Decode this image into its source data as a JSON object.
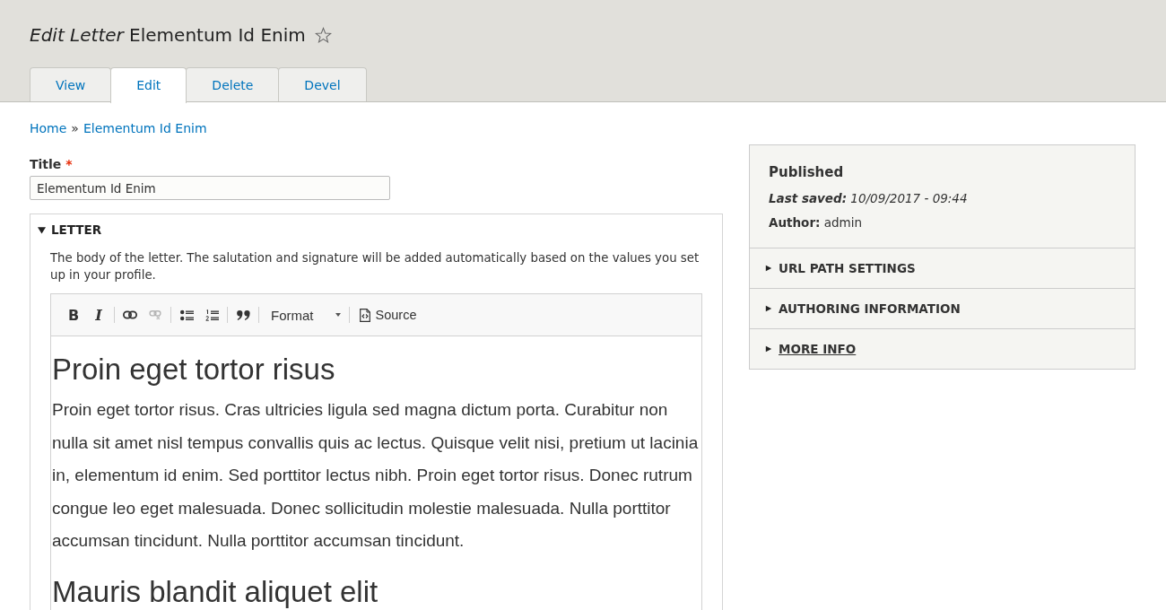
{
  "title": {
    "text": "*Edit Letter* Elementum Id Enim",
    "starred": false
  },
  "tabs": [
    {
      "label": "View",
      "selected": false
    },
    {
      "label": "Edit",
      "selected": true
    },
    {
      "label": "Delete",
      "selected": false
    },
    {
      "label": "Devel",
      "selected": false
    }
  ],
  "breadcrumb": {
    "links": [
      "Home",
      "Elementum Id Enim"
    ],
    "separator": "»"
  },
  "title_field": {
    "label": "Title",
    "required_mark": "*",
    "value": "Elementum Id Enim"
  },
  "letter": {
    "legend": "LETTER",
    "expanded": true,
    "description": "The body of the letter. The salutation and signature will be added automatically based on the values you set up in your profile.",
    "toolbar": {
      "groups": [
        {
          "buttons": [
            {
              "kind": "bold",
              "label": "B",
              "disabled": false
            },
            {
              "kind": "italic",
              "label": "I",
              "disabled": false
            }
          ]
        },
        {
          "buttons": [
            {
              "kind": "link",
              "disabled": false
            },
            {
              "kind": "unlink",
              "disabled": true
            }
          ]
        },
        {
          "buttons": [
            {
              "kind": "bulleted_list",
              "disabled": false
            },
            {
              "kind": "numbered_list",
              "disabled": false
            }
          ]
        },
        {
          "buttons": [
            {
              "kind": "blockquote",
              "disabled": false
            }
          ]
        },
        {
          "buttons": [
            {
              "kind": "format",
              "label": "Format",
              "disabled": false
            }
          ]
        },
        {
          "buttons": [
            {
              "kind": "source",
              "label": "Source",
              "disabled": false
            }
          ]
        }
      ]
    },
    "content": [
      {
        "kind": "heading",
        "text": "Proin eget tortor risus"
      },
      {
        "kind": "paragraph",
        "text": "Proin eget tortor risus. Cras ultricies ligula sed magna dictum porta. Curabitur non nulla sit amet nisl tempus convallis quis ac lectus. Quisque velit nisi, pretium ut lacinia in, elementum id enim. Sed porttitor lectus nibh. Proin eget tortor risus. Donec rutrum congue leo eget malesuada. Donec sollicitudin molestie malesuada. Nulla porttitor accumsan tincidunt. Nulla porttitor accumsan tincidunt."
      },
      {
        "kind": "heading",
        "text": "Mauris blandit aliquet elit"
      }
    ]
  },
  "sidebar": {
    "status": "Published",
    "last_saved": "**Last saved:** 10/09/2017 - 09:44",
    "author": "**Author:** admin",
    "sections": [
      {
        "label": "URL PATH SETTINGS",
        "expanded": false,
        "focused": false
      },
      {
        "label": "AUTHORING INFORMATION",
        "expanded": false,
        "focused": false
      },
      {
        "label": "MORE INFO",
        "expanded": false,
        "focused": true
      }
    ]
  }
}
